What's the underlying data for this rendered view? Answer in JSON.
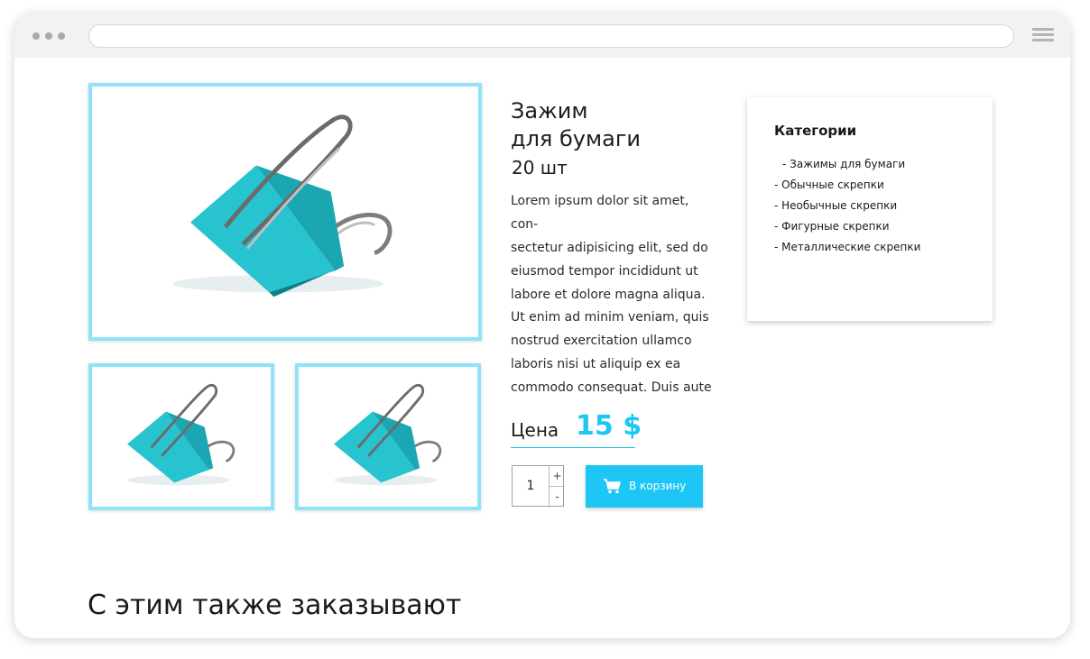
{
  "product": {
    "title_line1": "Зажим",
    "title_line2": "для бумаги",
    "quantity_label": "20 шт",
    "description_p1": [
      "Lorem ipsum dolor sit amet, con-",
      "sectetur adipisicing elit, sed do",
      "eiusmod tempor incididunt ut",
      "labore et dolore magna aliqua."
    ],
    "description_p2": [
      "Ut enim ad minim veniam, quis",
      "nostrud exercitation ullamco",
      "laboris nisi ut aliquip ex ea",
      "commodo consequat. Duis aute"
    ],
    "price_label": "Цена",
    "price_value": "15 $",
    "accent_color": "#1ec6f5",
    "image_border_color": "#8fe3f8"
  },
  "cart": {
    "quantity": "1",
    "plus": "+",
    "minus": "-",
    "button_label": "В корзину",
    "button_icon": "cart-icon"
  },
  "categories": {
    "title": "Категории",
    "items": [
      "- Зажимы для бумаги",
      "- Обычные скрепки",
      "- Необычные скрепки",
      "- Фигурные скрепки",
      "- Металлические скрепки"
    ]
  },
  "related": {
    "title": "С этим также заказывают"
  }
}
